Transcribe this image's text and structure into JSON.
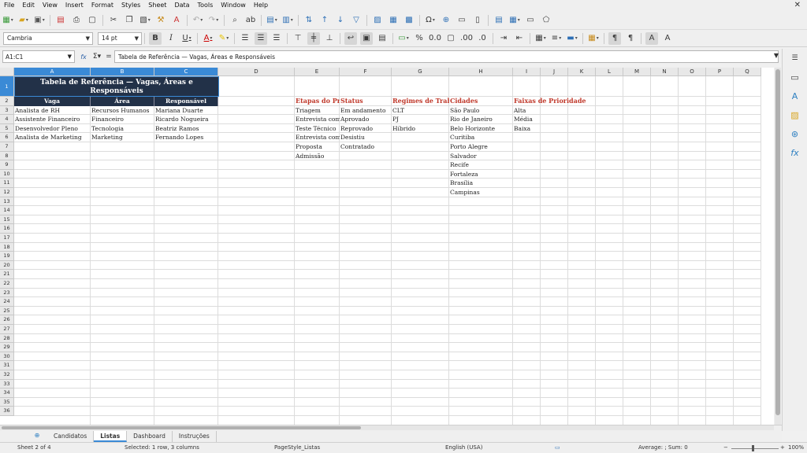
{
  "menu": [
    "File",
    "Edit",
    "View",
    "Insert",
    "Format",
    "Styles",
    "Sheet",
    "Data",
    "Tools",
    "Window",
    "Help"
  ],
  "toolbar": {
    "font_name": "Cambria",
    "font_size": "14 pt"
  },
  "formula_bar": {
    "cell_ref": "A1:C1",
    "content": "Tabela de Referência — Vagas, Áreas e Responsáveis"
  },
  "columns": [
    "A",
    "B",
    "C",
    "D",
    "E",
    "F",
    "G",
    "H",
    "I",
    "J",
    "K",
    "L",
    "M",
    "N",
    "O",
    "P",
    "Q"
  ],
  "rows": [
    "1",
    "2",
    "3",
    "4",
    "5",
    "6",
    "7",
    "8",
    "9",
    "10",
    "11",
    "12",
    "13",
    "14",
    "15",
    "16",
    "17",
    "18",
    "19",
    "20",
    "21",
    "22",
    "23",
    "24",
    "25",
    "26",
    "27",
    "28",
    "29",
    "30",
    "31",
    "32",
    "33",
    "34",
    "35",
    "36"
  ],
  "title": "Tabela de Referência — Vagas, Áreas e Responsáveis",
  "main_table": {
    "headers": [
      "Vaga",
      "Área",
      "Responsável"
    ],
    "rows": [
      [
        "Analista de RH",
        "Recursos Humanos",
        "Mariana Duarte"
      ],
      [
        "Assistente Financeiro",
        "Financeiro",
        "Ricardo Nogueira"
      ],
      [
        "Desenvolvedor Pleno",
        "Tecnologia",
        "Beatriz Ramos"
      ],
      [
        "Analista de Marketing",
        "Marketing",
        "Fernando Lopes"
      ]
    ]
  },
  "lists": {
    "etapas": {
      "header": "Etapas do Pr",
      "items": [
        "Triagem",
        "Entrevista com",
        "Teste Técnico",
        "Entrevista com",
        "Proposta",
        "Admissão"
      ]
    },
    "status": {
      "header": "Status",
      "items": [
        "Em andamento",
        "Aprovado",
        "Reprovado",
        "Desistiu",
        "Contratado"
      ]
    },
    "regimes": {
      "header": "Regimes de Trab",
      "items": [
        "CLT",
        "PJ",
        "Híbrido"
      ]
    },
    "cidades": {
      "header": "Cidades",
      "items": [
        "São Paulo",
        "Rio de Janeiro",
        "Belo Horizonte",
        "Curitiba",
        "Porto Alegre",
        "Salvador",
        "Recife",
        "Fortaleza",
        "Brasília",
        "Campinas"
      ]
    },
    "prioridade": {
      "header": "Faixas de Prioridade",
      "items": [
        "Alta",
        "Média",
        "Baixa"
      ]
    }
  },
  "sheet_tabs": [
    "Candidatos",
    "Listas",
    "Dashboard",
    "Instruções"
  ],
  "active_tab": "Listas",
  "status": {
    "sheet": "Sheet 2 of 4",
    "selection": "Selected: 1 row, 3 columns",
    "page_style": "PageStyle_Listas",
    "language": "English (USA)",
    "aggregate": "Average: ; Sum: 0",
    "zoom": "100%"
  }
}
